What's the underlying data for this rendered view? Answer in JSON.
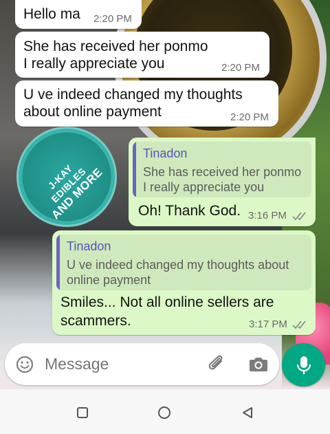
{
  "messages": [
    {
      "direction": "incoming",
      "text": "Hello ma",
      "time": "2:20 PM"
    },
    {
      "direction": "incoming",
      "text_lines": [
        "She has received her ponmo",
        "I really appreciate you"
      ],
      "time": "2:20 PM"
    },
    {
      "direction": "incoming",
      "text_lines": [
        "U ve indeed changed my thoughts",
        "about online payment"
      ],
      "time": "2:20 PM"
    },
    {
      "direction": "outgoing",
      "quote": {
        "author": "Tinadon",
        "text_lines": [
          "She has received her ponmo",
          "I really appreciate you"
        ]
      },
      "text": "Oh! Thank God.",
      "time": "3:16 PM",
      "status": "read"
    },
    {
      "direction": "outgoing",
      "quote": {
        "author": "Tinadon",
        "text_lines": [
          "U ve indeed changed my thoughts about",
          "online payment"
        ]
      },
      "text_lines": [
        "Smiles... Not all online sellers are",
        "scammers."
      ],
      "time": "3:17 PM",
      "status": "read"
    }
  ],
  "wallpaper": {
    "stamp_lines": [
      "J-KAY EDIBLES",
      "AND MORE"
    ]
  },
  "composer": {
    "placeholder": "Message",
    "icons": [
      "emoji-icon",
      "attach-icon",
      "camera-icon",
      "mic-icon"
    ]
  },
  "navigation": {
    "icons": [
      "recents-icon",
      "home-icon",
      "back-icon"
    ]
  },
  "colors": {
    "incoming_bubble": "#ffffff",
    "outgoing_bubble": "#dcf8c6",
    "quote_bar": "#6b63c4",
    "quote_author": "#5a52b8",
    "mic_button": "#00a884"
  }
}
